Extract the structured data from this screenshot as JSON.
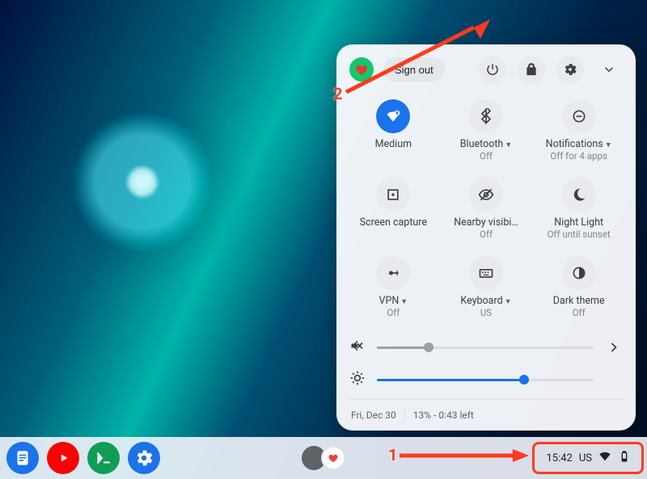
{
  "panel": {
    "sign_out": "Sign out",
    "tiles": [
      {
        "label": "Medium",
        "sub": "",
        "caret": false,
        "icon": "wifi",
        "on": true
      },
      {
        "label": "Bluetooth",
        "sub": "Off",
        "caret": true,
        "icon": "bluetooth",
        "on": false
      },
      {
        "label": "Notifications",
        "sub": "Off for 4 apps",
        "caret": true,
        "icon": "dnd",
        "on": false
      },
      {
        "label": "Screen capture",
        "sub": "",
        "caret": false,
        "icon": "capture",
        "on": false
      },
      {
        "label": "Nearby visibi…",
        "sub": "Off",
        "caret": false,
        "icon": "visibility-off",
        "on": false
      },
      {
        "label": "Night Light",
        "sub": "Off until sunset",
        "caret": false,
        "icon": "nightlight",
        "on": false
      },
      {
        "label": "VPN",
        "sub": "Off",
        "caret": true,
        "icon": "vpn",
        "on": false
      },
      {
        "label": "Keyboard",
        "sub": "US",
        "caret": true,
        "icon": "keyboard",
        "on": false
      },
      {
        "label": "Dark theme",
        "sub": "Off",
        "caret": false,
        "icon": "dark",
        "on": false
      }
    ],
    "volume_percent": 24,
    "brightness_percent": 68,
    "footer_date": "Fri, Dec 30",
    "footer_battery": "13% - 0:43 left"
  },
  "status": {
    "time": "15:42",
    "keyboard": "US"
  },
  "annotations": {
    "one": "1",
    "two": "2"
  }
}
